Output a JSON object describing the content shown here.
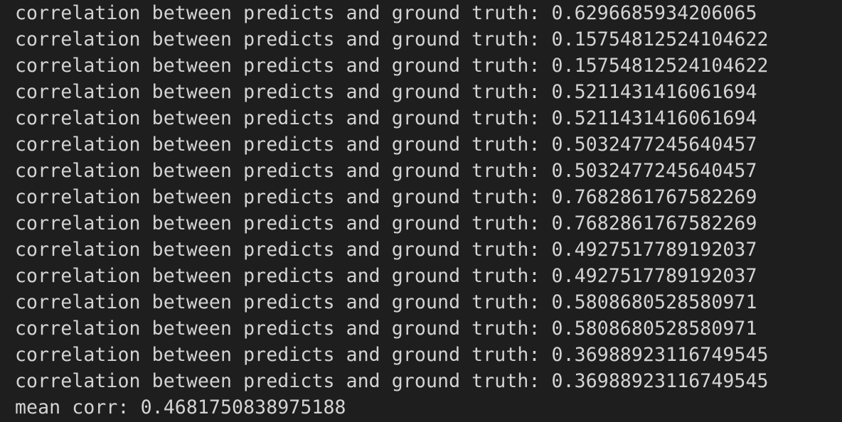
{
  "terminal": {
    "lines": [
      "correlation between predicts and ground truth: 0.6296685934206065",
      "correlation between predicts and ground truth: 0.15754812524104622",
      "correlation between predicts and ground truth: 0.15754812524104622",
      "correlation between predicts and ground truth: 0.5211431416061694",
      "correlation between predicts and ground truth: 0.5211431416061694",
      "correlation between predicts and ground truth: 0.5032477245640457",
      "correlation between predicts and ground truth: 0.5032477245640457",
      "correlation between predicts and ground truth: 0.7682861767582269",
      "correlation between predicts and ground truth: 0.7682861767582269",
      "correlation between predicts and ground truth: 0.4927517789192037",
      "correlation between predicts and ground truth: 0.4927517789192037",
      "correlation between predicts and ground truth: 0.5808680528580971",
      "correlation between predicts and ground truth: 0.5808680528580971",
      "correlation between predicts and ground truth: 0.36988923116749545",
      "correlation between predicts and ground truth: 0.36988923116749545",
      "mean corr: 0.4681750838975188"
    ],
    "background_color": "#1e1e1e",
    "text_color": "#d4d4d4"
  }
}
